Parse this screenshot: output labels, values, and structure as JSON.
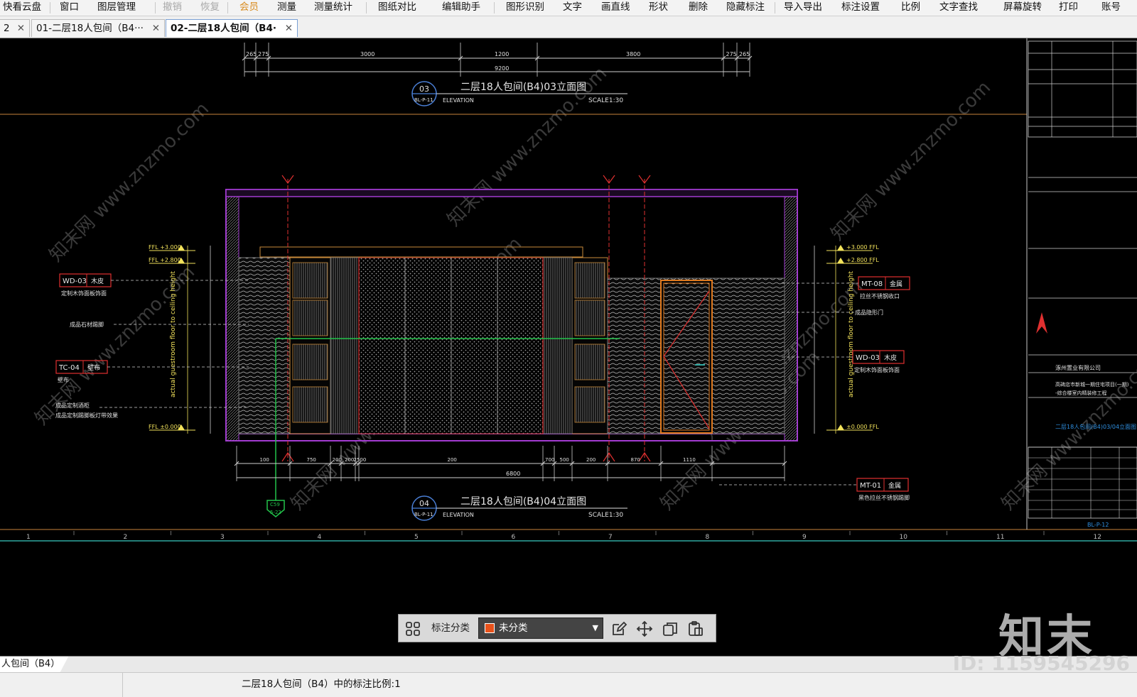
{
  "menu": [
    {
      "label": "快看云盘",
      "state": "normal"
    },
    {
      "label": "窗口",
      "state": "normal"
    },
    {
      "label": "图层管理",
      "state": "normal"
    },
    {
      "label": "撤销",
      "state": "disabled"
    },
    {
      "label": "恢复",
      "state": "disabled"
    },
    {
      "label": "会员",
      "state": "vip"
    },
    {
      "label": "测量",
      "state": "normal"
    },
    {
      "label": "测量统计",
      "state": "normal"
    },
    {
      "label": "图纸对比",
      "state": "normal"
    },
    {
      "label": "编辑助手",
      "state": "normal"
    },
    {
      "label": "图形识别",
      "state": "normal"
    },
    {
      "label": "文字",
      "state": "normal"
    },
    {
      "label": "画直线",
      "state": "normal"
    },
    {
      "label": "形状",
      "state": "normal"
    },
    {
      "label": "删除",
      "state": "normal"
    },
    {
      "label": "隐藏标注",
      "state": "normal"
    },
    {
      "label": "导入导出",
      "state": "normal"
    },
    {
      "label": "标注设置",
      "state": "normal"
    },
    {
      "label": "比例",
      "state": "normal"
    },
    {
      "label": "文字查找",
      "state": "normal"
    },
    {
      "label": "屏幕旋转",
      "state": "normal"
    },
    {
      "label": "打印",
      "state": "normal"
    },
    {
      "label": "账号",
      "state": "normal"
    }
  ],
  "tabs": [
    {
      "label": "2",
      "close": "✕",
      "active": false
    },
    {
      "label": "01-二层18人包间（B4···",
      "close": "✕",
      "active": false
    },
    {
      "label": "02-二层18人包间（B4·",
      "close": "✕",
      "active": true
    }
  ],
  "drawing": {
    "top_title": "二层18人包间(B4)03立面图",
    "top_code": "03",
    "top_sheet": "BL-P-11",
    "top_elevation": "ELEVATION",
    "top_scale": "SCALE1:30",
    "bottom_title": "二层18人包间(B4)04立面图",
    "bottom_code": "04",
    "bottom_sheet": "BL-P-11",
    "bottom_elevation": "ELEVATION",
    "bottom_scale": "SCALE1:30",
    "top_dims": [
      "265",
      "275",
      "3000",
      "1200",
      "3800",
      "275",
      "265"
    ],
    "top_total": "9200",
    "bottom_dims": [
      "100",
      "750",
      "200",
      "200",
      "2500",
      "200",
      "700",
      "500",
      "200",
      "870",
      "1110"
    ],
    "bottom_total": "6800",
    "left_levels": [
      "FFL +3.000",
      "FFL +2.800",
      "FFL ±0.000"
    ],
    "right_levels": [
      "+3.000 FFL",
      "+2.800 FFL",
      "±0.000 FFL"
    ],
    "left_vertical_text": "actual guestroom floor to ceiling height",
    "right_vertical_text": "actual guestroom floor to ceiling height",
    "left_tags": [
      {
        "code": "WD-03",
        "material": "木皮",
        "note": "定制木饰面板饰面"
      },
      {
        "code": "TC-04",
        "material": "壁布",
        "note": "壁布"
      }
    ],
    "left_notes": [
      "成品石材踢脚",
      "成品定制酒柜",
      "成品定制踢脚板灯带效果"
    ],
    "right_tags": [
      {
        "code": "MT-08",
        "material": "金属",
        "note": "拉丝不锈钢收口"
      },
      {
        "code": "WD-03",
        "material": "木皮",
        "note": "定制木饰面板饰面"
      },
      {
        "code": "MT-01",
        "material": "金属",
        "note": "黑色拉丝不锈钢踢脚"
      }
    ],
    "right_notes": [
      "成品隐形门"
    ],
    "section_mark_top": "C59",
    "section_mark_bottom": "5-22",
    "sheet_footer": "BL-P-12",
    "client": "涿州置业有限公司",
    "sheet_title": "二层18人包间(B4)03/04立面图",
    "project": "高碑店市新城一期住宅项目(一期)-综合楼室内精装修工程",
    "ruler": [
      "1",
      "2",
      "3",
      "4",
      "5",
      "6",
      "7",
      "8",
      "9",
      "10",
      "11",
      "12"
    ]
  },
  "watermark_text": "知末网 www.znzmo.com",
  "annotation_toolbar": {
    "label": "标注分类",
    "selected": "未分类",
    "dropdown_arrow": "▼",
    "swatch_color": "#e8521b"
  },
  "brand_watermark": "知末",
  "id_watermark": "ID: 1159545296",
  "layout_tab": "人包间（B4）",
  "status_text": "二层18人包间（B4）中的标注比例:1"
}
